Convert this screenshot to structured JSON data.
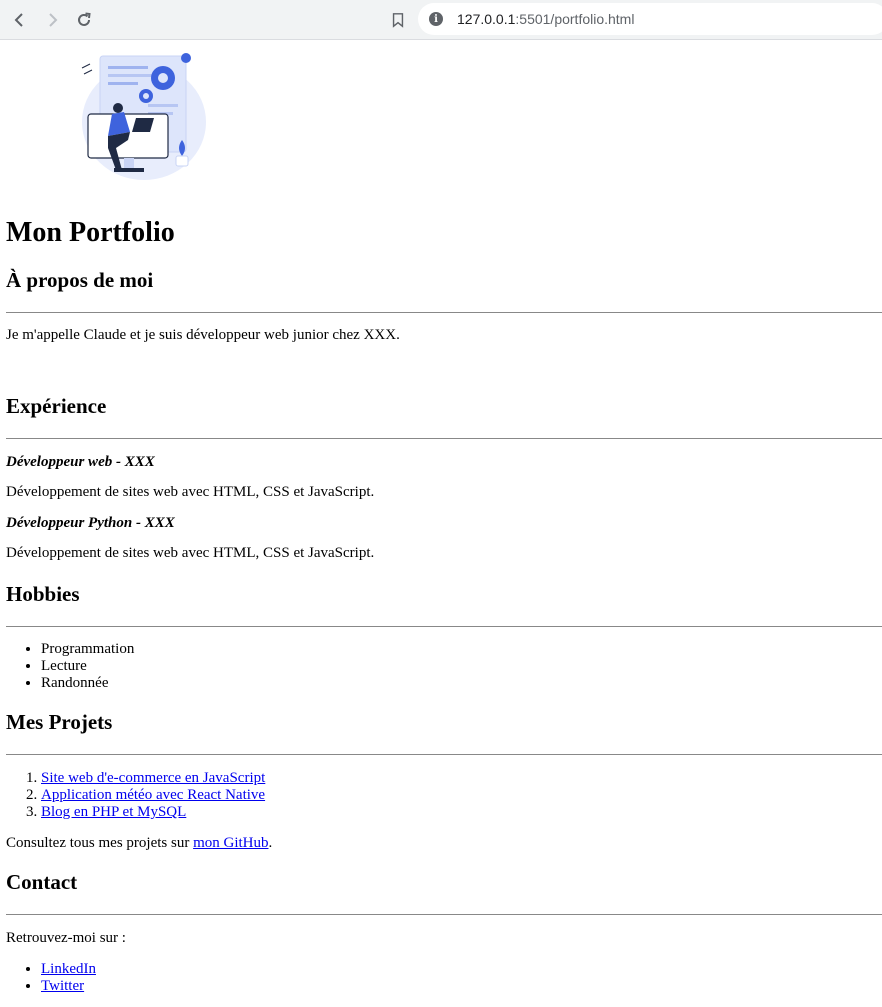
{
  "browser": {
    "url_host": "127.0.0.1",
    "url_rest": ":5501/portfolio.html"
  },
  "page": {
    "title": "Mon Portfolio",
    "about": {
      "heading": "À propos de moi",
      "text": "Je m'appelle Claude et je suis développeur web junior chez XXX."
    },
    "experience": {
      "heading": "Expérience",
      "items": [
        {
          "role": "Développeur web - XXX",
          "desc": "Développement de sites web avec HTML, CSS et JavaScript."
        },
        {
          "role": "Développeur Python - XXX",
          "desc": "Développement de sites web avec HTML, CSS et JavaScript."
        }
      ]
    },
    "hobbies": {
      "heading": "Hobbies",
      "items": [
        "Programmation",
        "Lecture",
        "Randonnée"
      ]
    },
    "projects": {
      "heading": "Mes Projets",
      "items": [
        "Site web d'e-commerce en JavaScript",
        "Application météo avec React Native",
        "Blog en PHP et MySQL"
      ],
      "github_prefix": "Consultez tous mes projets sur ",
      "github_link": "mon GitHub",
      "github_suffix": "."
    },
    "contact": {
      "heading": "Contact",
      "intro": "Retrouvez-moi sur :",
      "links": [
        "LinkedIn",
        "Twitter"
      ]
    }
  }
}
